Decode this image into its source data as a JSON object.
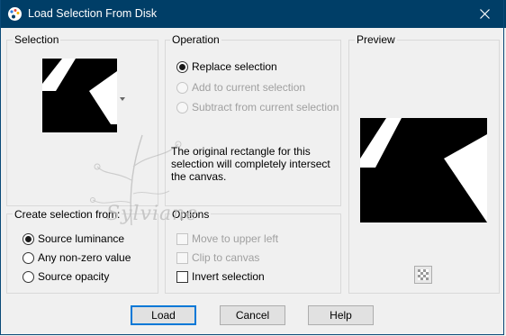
{
  "window": {
    "title": "Load Selection From Disk",
    "title_bar_color": "#003e67"
  },
  "selection_group": {
    "label": "Selection"
  },
  "operation_group": {
    "label": "Operation",
    "options": [
      {
        "label": "Replace selection",
        "checked": true,
        "disabled": false
      },
      {
        "label": "Add to current selection",
        "checked": false,
        "disabled": true
      },
      {
        "label": "Subtract from current selection",
        "checked": false,
        "disabled": true
      }
    ],
    "info": "The original rectangle for this selection will completely intersect the canvas."
  },
  "preview_group": {
    "label": "Preview"
  },
  "create_group": {
    "label": "Create selection from:",
    "options": [
      {
        "label": "Source luminance",
        "checked": true
      },
      {
        "label": "Any non-zero value",
        "checked": false
      },
      {
        "label": "Source opacity",
        "checked": false
      }
    ]
  },
  "options_group": {
    "label": "Options",
    "checks": [
      {
        "label": "Move to upper left",
        "checked": false,
        "disabled": true
      },
      {
        "label": "Clip to canvas",
        "checked": false,
        "disabled": true
      },
      {
        "label": "Invert selection",
        "checked": false,
        "disabled": false
      }
    ]
  },
  "buttons": {
    "load": "Load",
    "cancel": "Cancel",
    "help": "Help"
  },
  "watermark": "Sylviane",
  "icons": {
    "app": "palette-icon",
    "close": "close-icon",
    "transparency": "checkerboard-icon"
  }
}
